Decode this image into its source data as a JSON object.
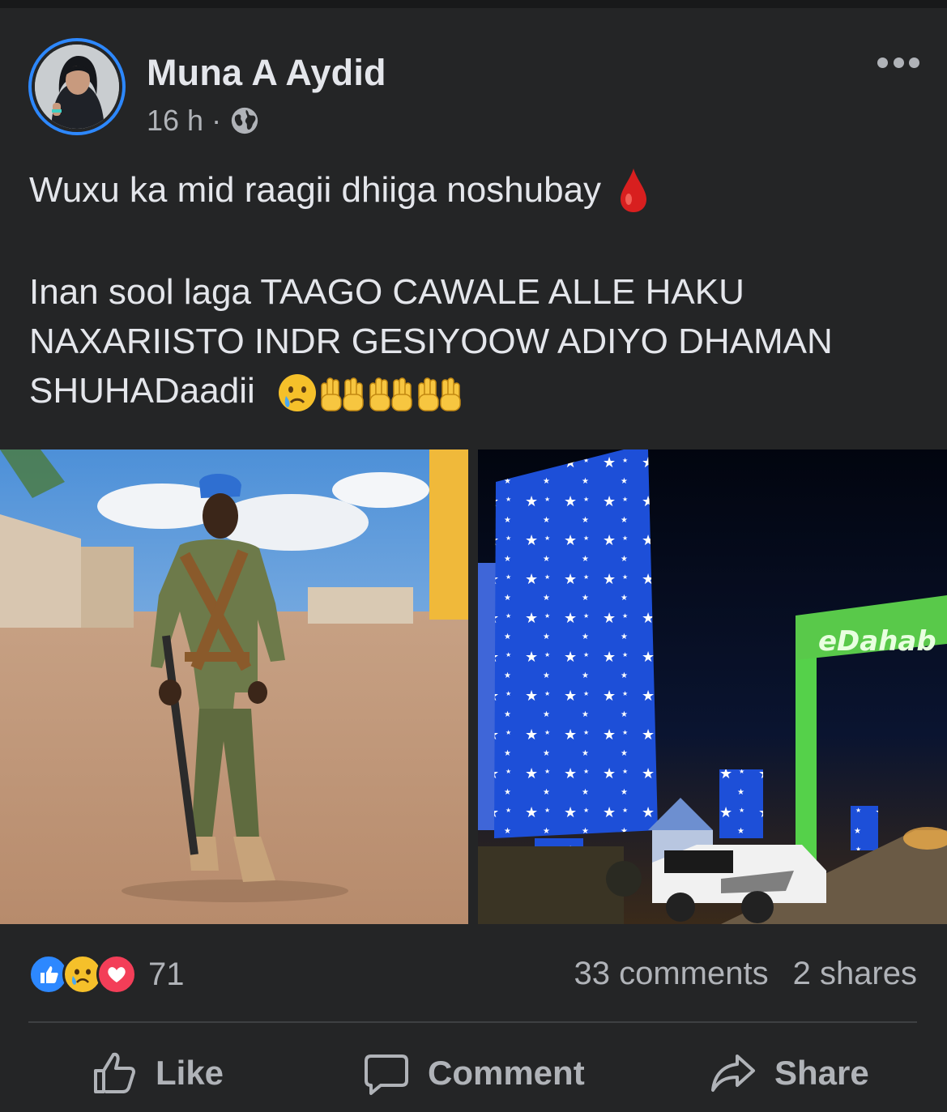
{
  "post": {
    "author": "Muna A Aydid",
    "time": "16 h",
    "separator": "·",
    "privacy_icon": "globe-icon",
    "menu_icon": "more-icon",
    "text_line1": "Wuxu ka mid raagii dhiiga noshubay",
    "text_line1_emoji": "drop-of-blood-icon",
    "text_para2": "Inan sool laga TAAGO CAWALE ALLE HAKU NAXARIISTO INDR GESIYOOW ADIYO DHAMAN SHUHADaadii",
    "text_para2_emojis": [
      "crying-face-icon",
      "raised-hands-icon",
      "raised-hands-icon",
      "raised-hands-icon"
    ],
    "photos": {
      "left": "soldier-photo",
      "right": "city-night-photo",
      "right_sign_text": "eDahab"
    }
  },
  "stats": {
    "reactions": [
      "like-reaction-icon",
      "sad-reaction-icon",
      "love-reaction-icon"
    ],
    "reaction_count": "71",
    "comments": "33 comments",
    "shares": "2 shares"
  },
  "actions": {
    "like": "Like",
    "comment": "Comment",
    "share": "Share"
  },
  "colors": {
    "background": "#242526",
    "text": "#e4e6eb",
    "secondary": "#b0b3b8",
    "accent": "#2d88ff"
  }
}
